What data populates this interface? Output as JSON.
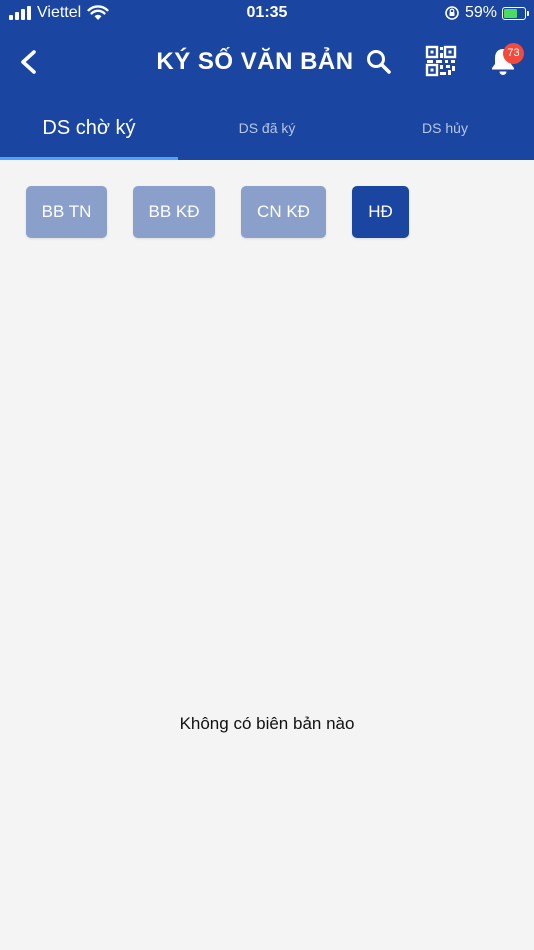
{
  "status_bar": {
    "carrier": "Viettel",
    "time": "01:35",
    "battery_percent": "59%"
  },
  "nav": {
    "title": "KÝ SỐ VĂN BẢN",
    "notification_count": "73",
    "icons": [
      "back-arrow-icon",
      "search-icon",
      "qr-code-icon",
      "bell-icon"
    ]
  },
  "tabs": [
    {
      "label": "DS chờ ký",
      "active": true
    },
    {
      "label": "DS đã ký",
      "active": false
    },
    {
      "label": "DS hủy",
      "active": false
    }
  ],
  "filters": [
    {
      "label": "BB TN",
      "active": false
    },
    {
      "label": "BB KĐ",
      "active": false
    },
    {
      "label": "CN KĐ",
      "active": false
    },
    {
      "label": "HĐ",
      "active": true
    }
  ],
  "empty_message": "Không có biên bản nào",
  "colors": {
    "header_bg": "#1a45a0",
    "chip_inactive": "#8aa0cb",
    "chip_active": "#1a45a0",
    "tab_indicator": "#4aa3ff",
    "badge": "#f24a3d",
    "page_bg": "#f4f4f4"
  }
}
